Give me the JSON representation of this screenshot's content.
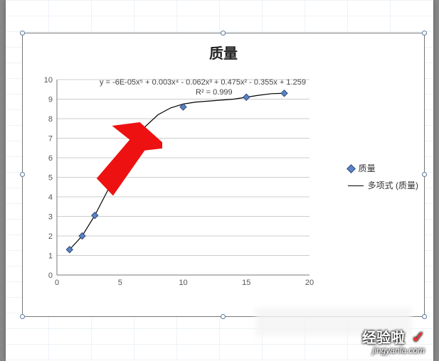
{
  "chart_data": {
    "type": "scatter",
    "title": "质量",
    "xlabel": "",
    "ylabel": "",
    "xlim": [
      0,
      20
    ],
    "ylim": [
      0,
      10
    ],
    "xticks": [
      0,
      5,
      10,
      15,
      20
    ],
    "yticks": [
      0,
      1,
      2,
      3,
      4,
      5,
      6,
      7,
      8,
      9,
      10
    ],
    "series": [
      {
        "name": "质量",
        "type": "scatter",
        "x": [
          1,
          2,
          3,
          10,
          15,
          18
        ],
        "y": [
          1.3,
          2.0,
          3.05,
          8.6,
          9.1,
          9.3
        ]
      },
      {
        "name": "多项式 (质量)",
        "type": "line",
        "x": [
          1,
          2,
          3,
          4,
          5,
          6,
          7,
          8,
          9,
          10,
          11,
          12,
          13,
          14,
          15,
          16,
          17,
          18
        ],
        "y": [
          1.3,
          2.0,
          3.05,
          4.3,
          5.6,
          6.7,
          7.6,
          8.2,
          8.55,
          8.75,
          8.85,
          8.9,
          8.95,
          9.0,
          9.1,
          9.2,
          9.28,
          9.3
        ]
      }
    ],
    "equation": "y = -6E-05x⁵ + 0.003x⁴ - 0.062x³ + 0.475x² - 0.355x + 1.259",
    "r_squared": "R² = 0.999"
  },
  "legend": {
    "series1": "质量",
    "series2": "多项式 (质量)"
  },
  "watermark": {
    "main": "经验啦",
    "sub": "jingyanla.com"
  }
}
